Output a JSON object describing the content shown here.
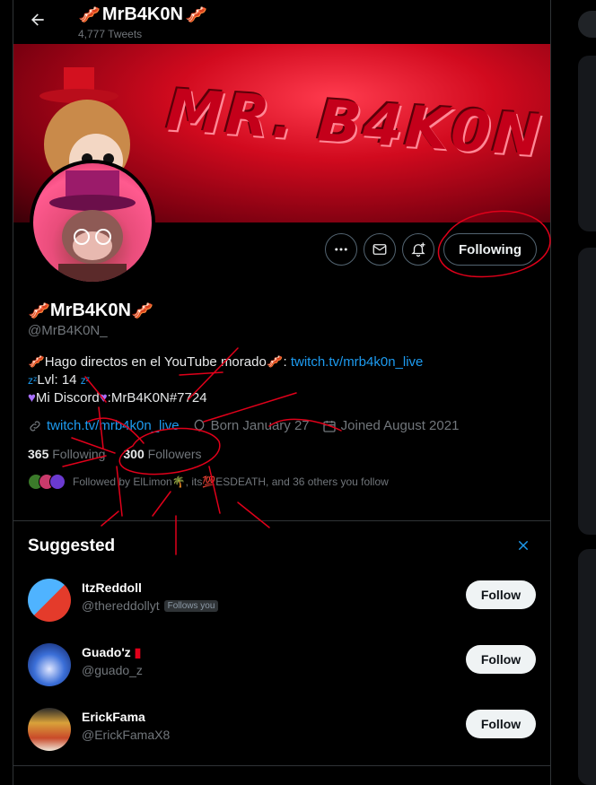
{
  "header": {
    "name": "MrB4K0N",
    "name_emoji_left": "🥓",
    "name_emoji_right": "🥓",
    "tweet_count": "4,777 Tweets"
  },
  "banner": {
    "text": "MR. B4K0N"
  },
  "actions": {
    "more_icon": "more-horizontal-icon",
    "message_icon": "envelope-icon",
    "notify_icon": "bell-plus-icon",
    "following_label": "Following"
  },
  "profile": {
    "name": "MrB4K0N",
    "handle": "@MrB4K0N_",
    "bio_line1_text": "Hago directos en el YouTube morado",
    "bio_line1_link": "twitch.tv/mrb4k0n_live",
    "bio_line2": "Lvl: 14",
    "bio_line3": "Mi Discord",
    "bio_line3_tag": ":MrB4K0N#7724",
    "meta_link": "twitch.tv/mrb4k0n_live",
    "birthday": "Born January 27",
    "joined": "Joined August 2021",
    "following_count": "365",
    "following_label": "Following",
    "followers_count": "300",
    "followers_label": "Followers",
    "followed_by": "Followed by ElLimon🌴, its💯ESDEATH, and 36 others you follow"
  },
  "suggested": {
    "title": "Suggested",
    "users": [
      {
        "name": "ItzReddoll",
        "handle": "@thereddollyt",
        "badge": "Follows you",
        "button": "Follow"
      },
      {
        "name": "Guado'z",
        "handle": "@guado_z",
        "badge": "",
        "button": "Follow"
      },
      {
        "name": "ErickFama",
        "handle": "@ErickFamaX8",
        "badge": "",
        "button": "Follow"
      }
    ]
  },
  "colors": {
    "accent": "#1d9bf0",
    "annotation": "#e0001a",
    "banner": "#d10a1e"
  }
}
